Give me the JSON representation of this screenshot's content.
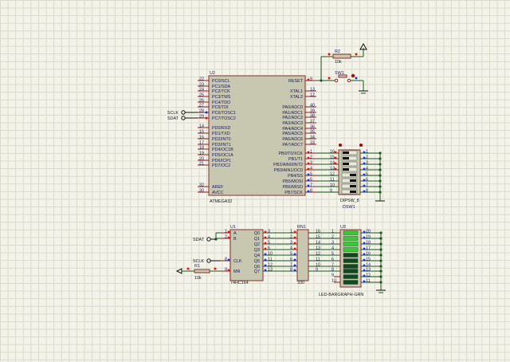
{
  "colors": {
    "body": "#c8c8b0",
    "border": "#8a3030",
    "wire": "#1a5a1a",
    "pin": "#8a2020",
    "led_on": "#33cc33",
    "led_off": "#0d4a1d",
    "pin_red": "#ff0000",
    "pin_blue": "#0030ff"
  },
  "u2": {
    "ref": "U2",
    "part": "ATMEGA32",
    "left": [
      [
        "22",
        "PC0/SCL"
      ],
      [
        "23",
        "PC1/SDA"
      ],
      [
        "24",
        "PC2/TCK"
      ],
      [
        "25",
        "PC3/TMS"
      ],
      [
        "26",
        "PC4/TDO"
      ],
      [
        "27",
        "PC5/TDI"
      ],
      [
        "28",
        "PC6/TOSC1"
      ],
      [
        "29",
        "PC7/TOSC2"
      ],
      [
        "14",
        "PD0/RXD"
      ],
      [
        "15",
        "PD1/TXD"
      ],
      [
        "16",
        "PD2/INT0"
      ],
      [
        "17",
        "PD3/INT1"
      ],
      [
        "18",
        "PD4/OC1B"
      ],
      [
        "19",
        "PD5/OC1A"
      ],
      [
        "20",
        "PD6/ICP1"
      ],
      [
        "21",
        "PD7/OC2"
      ],
      [
        "32",
        "AREF"
      ],
      [
        "30",
        "AVCC"
      ]
    ],
    "right": [
      [
        "9",
        "RESET"
      ],
      [
        "13",
        "XTAL1"
      ],
      [
        "12",
        "XTAL2"
      ],
      [
        "40",
        "PA0/ADC0"
      ],
      [
        "39",
        "PA1/ADC1"
      ],
      [
        "38",
        "PA2/ADC2"
      ],
      [
        "37",
        "PA3/ADC3"
      ],
      [
        "36",
        "PA4/ADC4"
      ],
      [
        "35",
        "PA5/ADC5"
      ],
      [
        "34",
        "PA6/ADC6"
      ],
      [
        "33",
        "PA7/ADC7"
      ],
      [
        "1",
        "PB0/T0/XCK"
      ],
      [
        "2",
        "PB1/T1"
      ],
      [
        "3",
        "PB2/AIN0/INT2"
      ],
      [
        "4",
        "PB3/AIN1/OC0"
      ],
      [
        "5",
        "PB4/SS"
      ],
      [
        "6",
        "PB5/MOSI"
      ],
      [
        "7",
        "PB6/MISO"
      ],
      [
        "8",
        "PB7/SCK"
      ]
    ]
  },
  "terminals": {
    "sclk": "SCLK",
    "sdat": "SDAT"
  },
  "r2": {
    "ref": "R2",
    "value": "10k"
  },
  "sw1": {
    "ref": "SW1"
  },
  "dsw1": {
    "ref": "DSW1",
    "part": "DIPSW_8",
    "left": [
      "16",
      "15",
      "14",
      "13",
      "12",
      "11",
      "10",
      "9"
    ],
    "right": [
      "1",
      "2",
      "3",
      "4",
      "5",
      "6",
      "7",
      "8"
    ],
    "states": [
      0,
      0,
      0,
      0,
      1,
      1,
      1,
      1
    ]
  },
  "u1": {
    "ref": "U1",
    "part": "74HC164",
    "left": [
      [
        "1",
        "A"
      ],
      [
        "2",
        "B"
      ],
      [
        "8",
        "CLK"
      ],
      [
        "9",
        "MR"
      ]
    ],
    "right": [
      [
        "3",
        "Q0"
      ],
      [
        "4",
        "Q1"
      ],
      [
        "5",
        "Q2"
      ],
      [
        "6",
        "Q3"
      ],
      [
        "10",
        "Q4"
      ],
      [
        "11",
        "Q5"
      ],
      [
        "12",
        "Q6"
      ],
      [
        "13",
        "Q7"
      ]
    ]
  },
  "r1": {
    "ref": "R1",
    "value": "10k"
  },
  "rn1": {
    "ref": "RN1",
    "value": "330",
    "left": [
      "1",
      "2",
      "3",
      "4",
      "5",
      "6",
      "7",
      "8"
    ],
    "right": [
      "16",
      "15",
      "14",
      "13",
      "12",
      "11",
      "10",
      "9"
    ]
  },
  "u3": {
    "ref": "U3",
    "part": "LED-BARGRAPH-GRN",
    "left": [
      "1",
      "2",
      "3",
      "4",
      "5",
      "6",
      "7",
      "8",
      "9",
      "10"
    ],
    "right": [
      "20",
      "19",
      "18",
      "17",
      "16",
      "15",
      "14",
      "13",
      "12",
      "11"
    ],
    "lit": [
      1,
      1,
      1,
      1,
      0,
      0,
      0,
      0,
      0,
      0
    ]
  }
}
